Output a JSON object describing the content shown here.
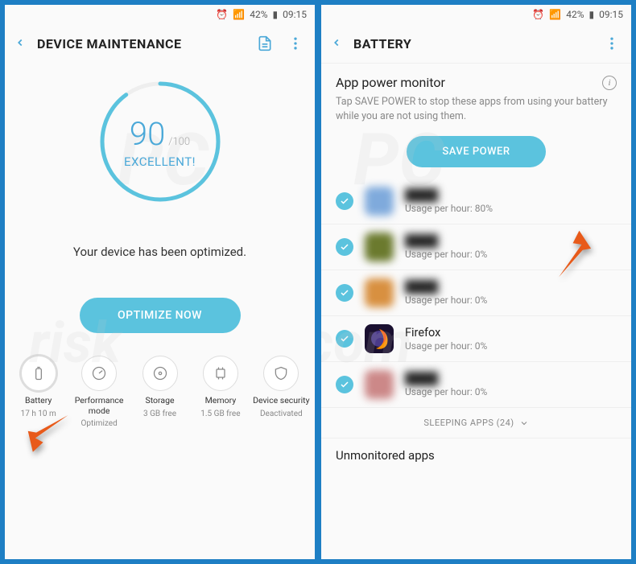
{
  "status": {
    "battery_pct": "42%",
    "time": "09:15"
  },
  "left": {
    "title": "DEVICE MAINTENANCE",
    "score": "90",
    "score_max": "/100",
    "rating": "EXCELLENT!",
    "message": "Your device has been optimized.",
    "optimize_btn": "OPTIMIZE NOW",
    "tiles": [
      {
        "label": "Battery",
        "sub": "17 h 10 m"
      },
      {
        "label": "Performance mode",
        "sub": "Optimized"
      },
      {
        "label": "Storage",
        "sub": "3 GB free"
      },
      {
        "label": "Memory",
        "sub": "1.5 GB free"
      },
      {
        "label": "Device security",
        "sub": "Deactivated"
      }
    ]
  },
  "right": {
    "title": "BATTERY",
    "section": "App power monitor",
    "desc": "Tap SAVE POWER to stop these apps from using your battery while you are not using them.",
    "save_btn": "SAVE POWER",
    "usage_prefix": "Usage per hour: ",
    "apps": [
      {
        "name": "",
        "usage": "80%",
        "color": "#7faadc",
        "blur": true
      },
      {
        "name": "",
        "usage": "0%",
        "color": "#6b7a2e",
        "blur": true
      },
      {
        "name": "",
        "usage": "0%",
        "color": "#d89040",
        "blur": true
      },
      {
        "name": "Firefox",
        "usage": "0%",
        "color": "#1a1030",
        "blur": false
      },
      {
        "name": "",
        "usage": "0%",
        "color": "#c88",
        "blur": true
      }
    ],
    "sleeping": "SLEEPING APPS (24)",
    "unmonitored": "Unmonitored apps"
  }
}
